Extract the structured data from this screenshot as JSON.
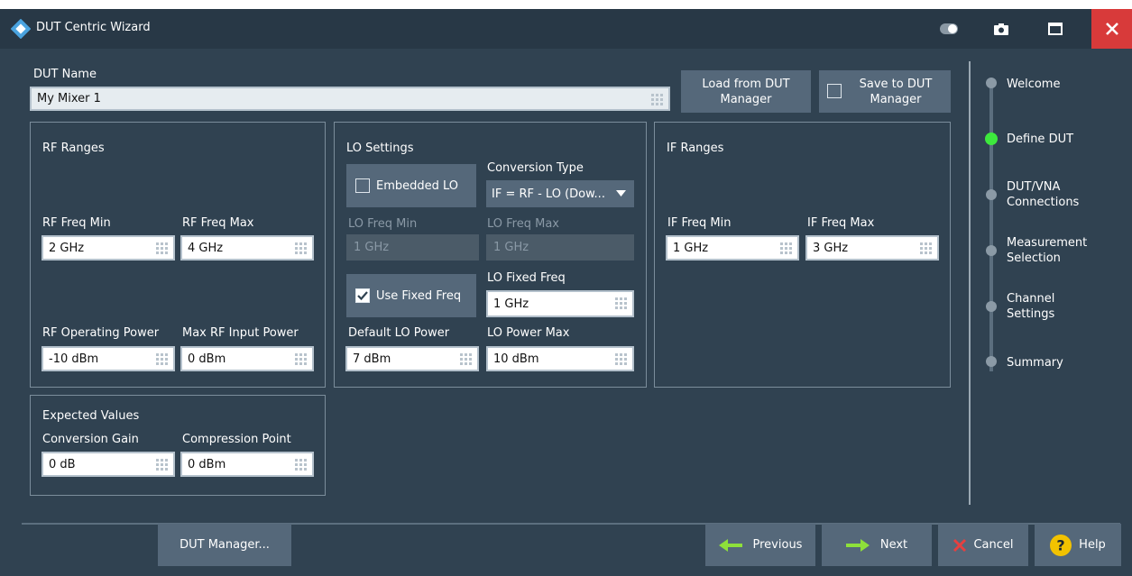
{
  "window": {
    "title": "DUT Centric Wizard"
  },
  "dut": {
    "name_label": "DUT Name",
    "name_value": "My Mixer 1",
    "load_button": "Load from DUT Manager",
    "save_button": "Save to DUT Manager"
  },
  "rf": {
    "title": "RF Ranges",
    "freq_min_label": "RF Freq Min",
    "freq_min_value": "2 GHz",
    "freq_max_label": "RF Freq Max",
    "freq_max_value": "4 GHz",
    "op_power_label": "RF Operating Power",
    "op_power_value": "-10 dBm",
    "max_input_label": "Max RF Input Power",
    "max_input_value": "0 dBm"
  },
  "lo": {
    "title": "LO Settings",
    "embedded_label": "Embedded LO",
    "conversion_type_label": "Conversion Type",
    "conversion_type_value": "IF = RF - LO (Dow...",
    "freq_min_label": "LO Freq Min",
    "freq_min_value": "1 GHz",
    "freq_max_label": "LO Freq Max",
    "freq_max_value": "1 GHz",
    "use_fixed_label": "Use Fixed Freq",
    "use_fixed_checked": true,
    "fixed_freq_label": "LO Fixed Freq",
    "fixed_freq_value": "1 GHz",
    "default_power_label": "Default LO Power",
    "default_power_value": "7 dBm",
    "power_max_label": "LO Power Max",
    "power_max_value": "10 dBm"
  },
  "if": {
    "title": "IF Ranges",
    "freq_min_label": "IF Freq Min",
    "freq_min_value": "1 GHz",
    "freq_max_label": "IF Freq Max",
    "freq_max_value": "3 GHz"
  },
  "expected": {
    "title": "Expected Values",
    "gain_label": "Conversion Gain",
    "gain_value": "0 dB",
    "compression_label": "Compression Point",
    "compression_value": "0 dBm"
  },
  "steps": [
    {
      "label": "Welcome",
      "active": false
    },
    {
      "label": "Define DUT",
      "active": true
    },
    {
      "label": "DUT/VNA Connections",
      "active": false
    },
    {
      "label": "Measurement Selection",
      "active": false
    },
    {
      "label": "Channel Settings",
      "active": false
    },
    {
      "label": "Summary",
      "active": false
    }
  ],
  "footer": {
    "dut_manager": "DUT Manager...",
    "previous": "Previous",
    "next": "Next",
    "cancel": "Cancel",
    "help": "Help"
  },
  "colors": {
    "background": "#304251",
    "titlebar": "#283846",
    "close": "#d83a3a",
    "active_step": "#3de83d",
    "arrow": "#8ee03a",
    "help": "#f2c200"
  }
}
